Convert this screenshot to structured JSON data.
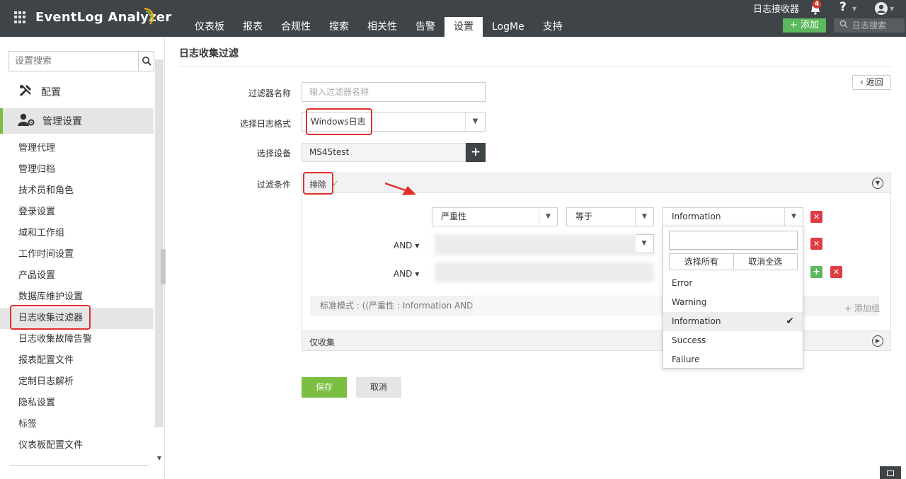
{
  "app": {
    "brand": "EventLog Analyzer",
    "nav": [
      "仪表板",
      "报表",
      "合规性",
      "搜索",
      "相关性",
      "告警",
      "设置",
      "LogMe",
      "支持"
    ],
    "active_nav": "设置",
    "log_receiver": "日志接收器",
    "notification_count": "4",
    "help_label": "?",
    "add_label": "添加",
    "log_search_label": "日志搜索"
  },
  "sidebar": {
    "search_placeholder": "设置搜索",
    "config_label": "配置",
    "mgmt_label": "管理设置",
    "items": [
      "管理代理",
      "管理归档",
      "技术员和角色",
      "登录设置",
      "域和工作组",
      "工作时间设置",
      "产品设置",
      "数据库维护设置",
      "日志收集过滤器",
      "日志收集故障告警",
      "报表配置文件",
      "定制日志解析",
      "隐私设置",
      "标签",
      "仪表板配置文件"
    ],
    "active_item": "日志收集过滤器"
  },
  "page": {
    "title": "日志收集过滤",
    "back_label": "返回",
    "filter_name_label": "过滤器名称",
    "filter_name_placeholder": "输入过滤器名称",
    "log_format_label": "选择日志格式",
    "log_format_value": "Windows日志",
    "device_label": "选择设备",
    "device_value": "MS45test",
    "condition_label": "过滤条件",
    "exclude_label": "排除",
    "collect_only_label": "仅收集",
    "std_pattern": "标准模式 : ((严重性 : Information AND",
    "add_group_label": "+ 添加组",
    "save_label": "保存",
    "cancel_label": "取消"
  },
  "conditions": {
    "row1": {
      "field": "严重性",
      "operator": "等于",
      "value": "Information"
    },
    "and_label": "AND"
  },
  "dropdown": {
    "select_all": "选择所有",
    "deselect_all": "取消全选",
    "options": [
      "Error",
      "Warning",
      "Information",
      "Success",
      "Failure"
    ],
    "selected": "Information"
  },
  "colors": {
    "topbar": "#3f4449",
    "accent_green": "#7bbf42",
    "delete_red": "#e03c44",
    "highlight_red": "#e0302c"
  }
}
